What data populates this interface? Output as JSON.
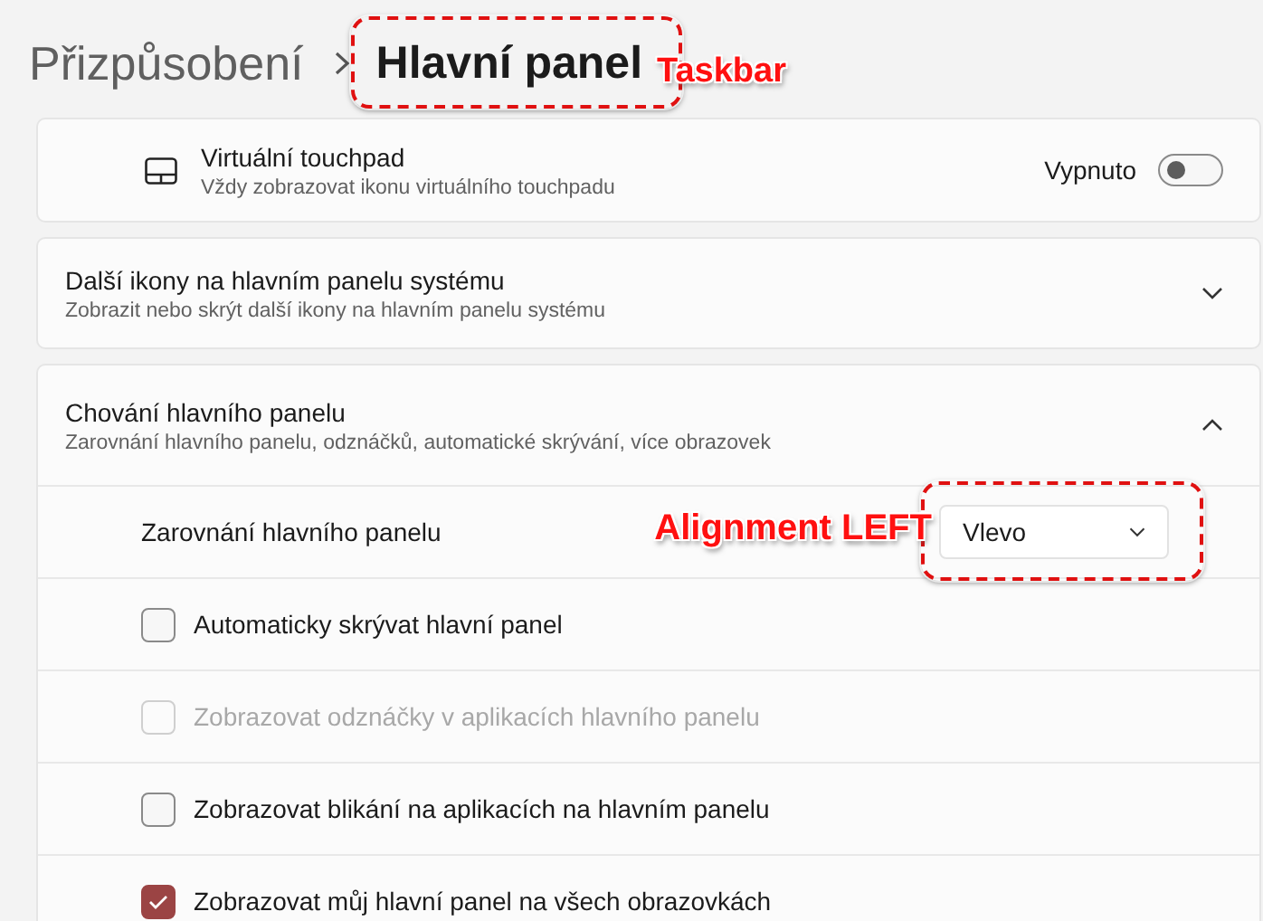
{
  "breadcrumb": [
    {
      "text": "Přizpůsobení",
      "current": false
    },
    {
      "text": "Hlavní panel",
      "current": true,
      "annotation": "Taskbar"
    }
  ],
  "settings": [
    {
      "kind": "toggle",
      "title": "Virtuální touchpad",
      "description": "Vždy zobrazovat ikonu virtuálního touchpadu",
      "state_label": "Vypnuto",
      "on": false
    },
    {
      "kind": "expander",
      "title": "Další ikony na hlavním panelu systému",
      "description": "Zobrazit nebo skrýt další ikony na hlavním panelu systému",
      "expanded": false
    },
    {
      "kind": "expander",
      "title": "Chování hlavního panelu",
      "description": "Zarovnání hlavního panelu, odznáčků, automatické skrývání, více obrazovek",
      "expanded": true,
      "children": [
        {
          "kind": "dropdown",
          "label": "Zarovnání hlavního panelu",
          "value": "Vlevo",
          "annotation": "Alignment LEFT"
        },
        {
          "kind": "checkbox",
          "label": "Automaticky skrývat hlavní panel",
          "checked": false,
          "disabled": false
        },
        {
          "kind": "checkbox",
          "label": "Zobrazovat odznáčky v aplikacích hlavního panelu",
          "checked": false,
          "disabled": true
        },
        {
          "kind": "checkbox",
          "label": "Zobrazovat blikání na aplikacích na hlavním panelu",
          "checked": false,
          "disabled": false
        },
        {
          "kind": "checkbox",
          "label": "Zobrazovat můj hlavní panel na všech obrazovkách",
          "checked": true,
          "disabled": false
        }
      ]
    }
  ]
}
